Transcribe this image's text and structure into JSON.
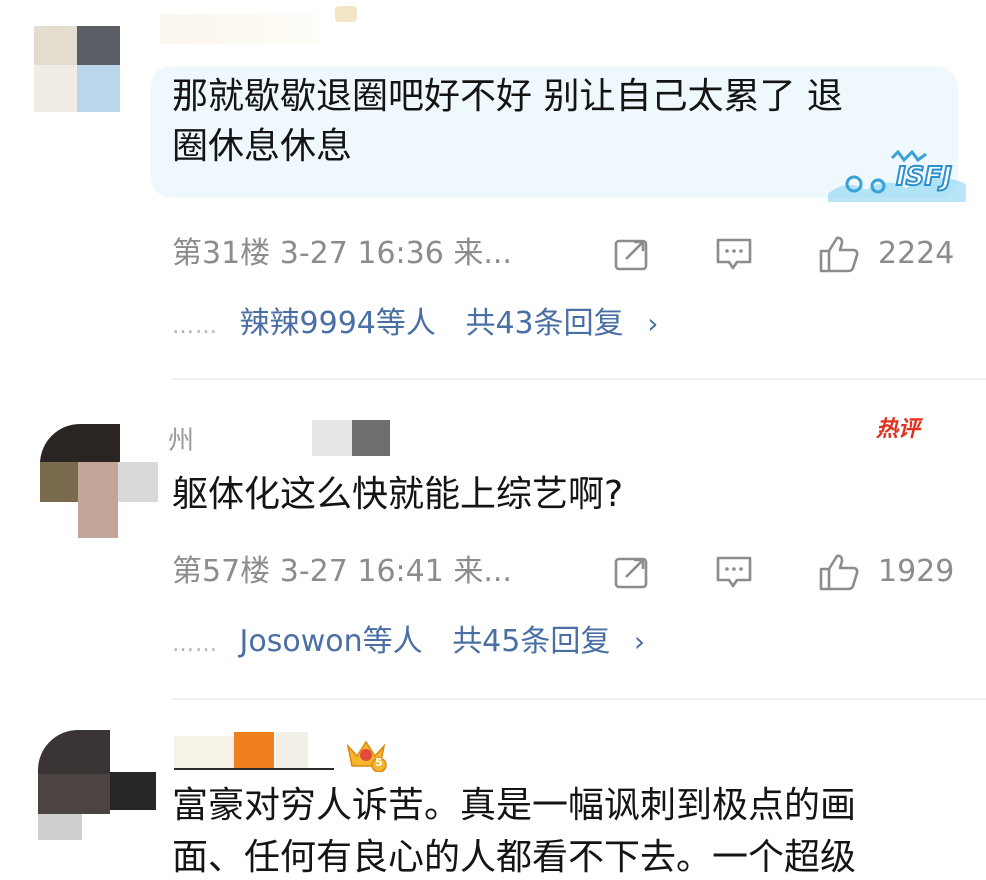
{
  "comments": [
    {
      "text_lines": [
        "那就歇歇退圈吧好不好 别让自己太累了 退",
        "圈休息休息"
      ],
      "floor": "第31楼",
      "datetime": "3-27 16:36",
      "source_trunc": "来...",
      "likes": "2224",
      "reply_users": "辣辣9994等人",
      "reply_count": "共43条回复",
      "badge": "ISFJ"
    },
    {
      "name_fragment": "州",
      "text_lines": [
        "躯体化这么快就能上综艺啊?"
      ],
      "floor": "第57楼",
      "datetime": "3-27 16:41",
      "source_trunc": "来...",
      "likes": "1929",
      "reply_users": "Josowon等人",
      "reply_count": "共45条回复",
      "hot_label": "热评"
    },
    {
      "text_lines": [
        "富豪对穷人诉苦。真是一幅讽刺到极点的画",
        "面、任何有良心的人都看不下去。一个超级"
      ],
      "crown_level": "5"
    }
  ],
  "icons": {
    "share": "share-icon",
    "comment": "comment-icon",
    "like": "thumbs-up-icon",
    "chevron": "chevron-right-icon",
    "crown": "crown-icon"
  },
  "colors": {
    "link_blue": "#4a6fa5",
    "meta_gray": "#8c8c8c",
    "hot_red": "#e0321f",
    "bubble_bg": "#eef8fd"
  }
}
